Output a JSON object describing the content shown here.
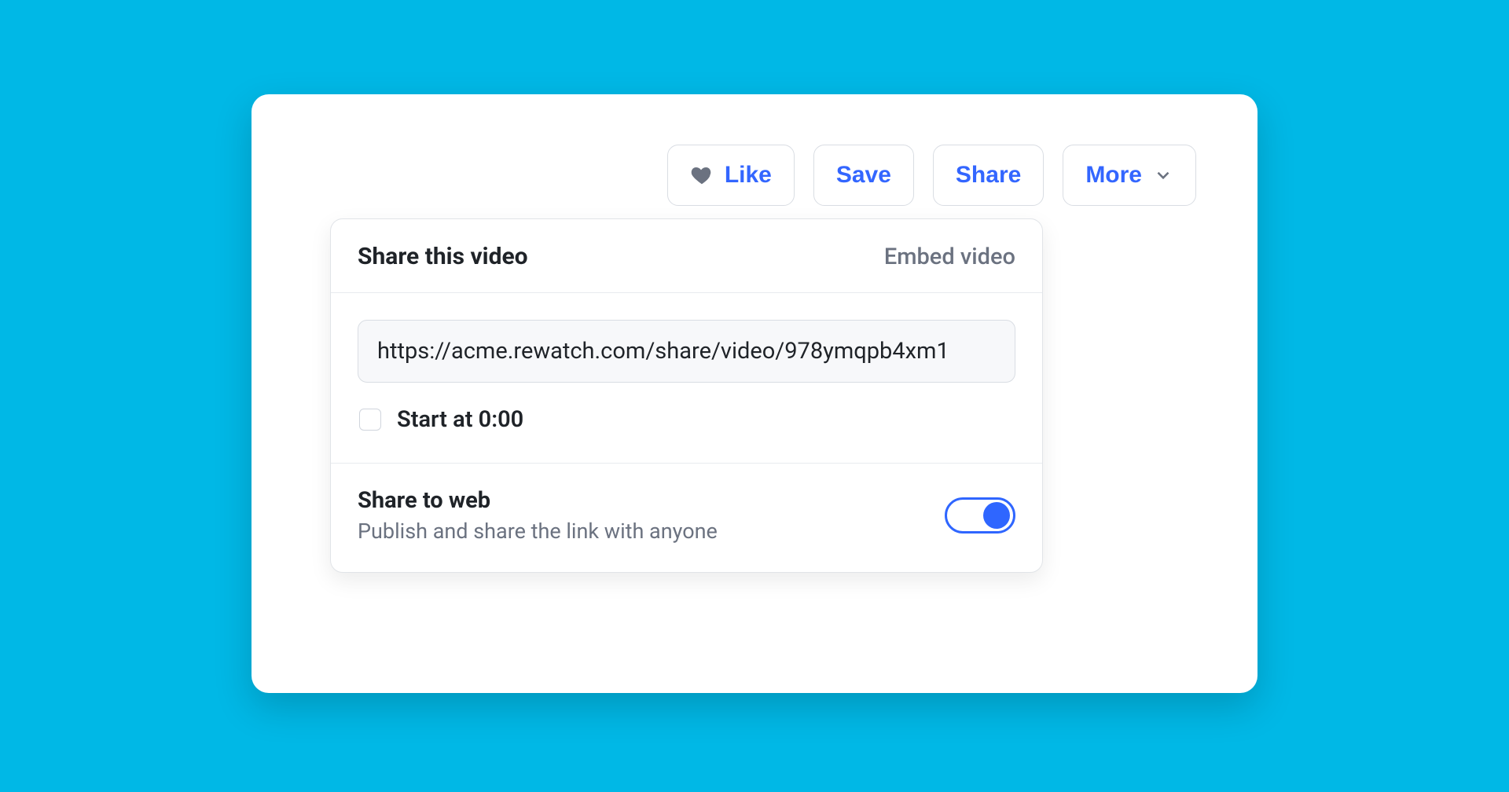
{
  "toolbar": {
    "like_label": "Like",
    "save_label": "Save",
    "share_label": "Share",
    "more_label": "More"
  },
  "share_popover": {
    "title": "Share this video",
    "embed_label": "Embed video",
    "url": "https://acme.rewatch.com/share/video/978ymqpb4xm1",
    "start_at_label": "Start at 0:00",
    "share_to_web_title": "Share to web",
    "share_to_web_subtitle": "Publish and share the link with anyone",
    "share_to_web_enabled": true
  }
}
